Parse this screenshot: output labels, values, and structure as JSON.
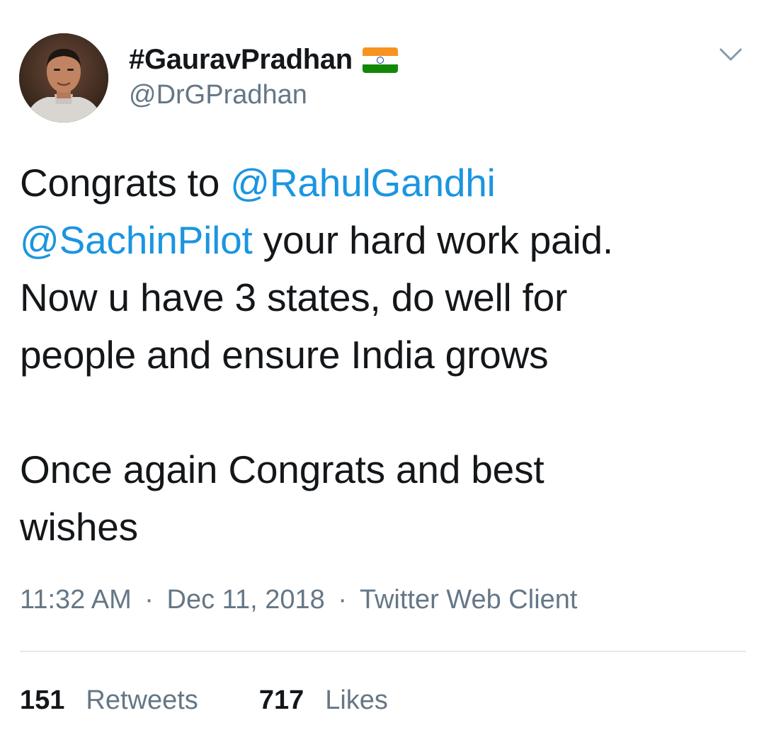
{
  "colors": {
    "accent": "#1b95e0",
    "text": "#14171a",
    "secondary": "#657786",
    "flag_saffron": "#f7931e",
    "flag_white": "#ffffff",
    "flag_green": "#138808",
    "flag_chakra": "#0b2e8f"
  },
  "author": {
    "display_name": "#GauravPradhan",
    "handle": "@DrGPradhan",
    "badge_icon": "india-flag-icon"
  },
  "tweet": {
    "line1_prefix": "Congrats to ",
    "line1_mention": "@RahulGandhi",
    "line2_mention": "@SachinPilot",
    "line2_suffix": " your hard work paid.",
    "line3": "Now u have 3 states, do well for",
    "line4": "people and ensure India grows",
    "line5": "Once again Congrats and best",
    "line6": "wishes"
  },
  "meta": {
    "time": "11:32 AM",
    "separator": "·",
    "date": "Dec 11, 2018",
    "source": "Twitter Web Client"
  },
  "stats": {
    "retweets_count": "151",
    "retweets_label": "Retweets",
    "likes_count": "717",
    "likes_label": "Likes"
  },
  "icons": {
    "menu": "chevron-down-icon"
  }
}
